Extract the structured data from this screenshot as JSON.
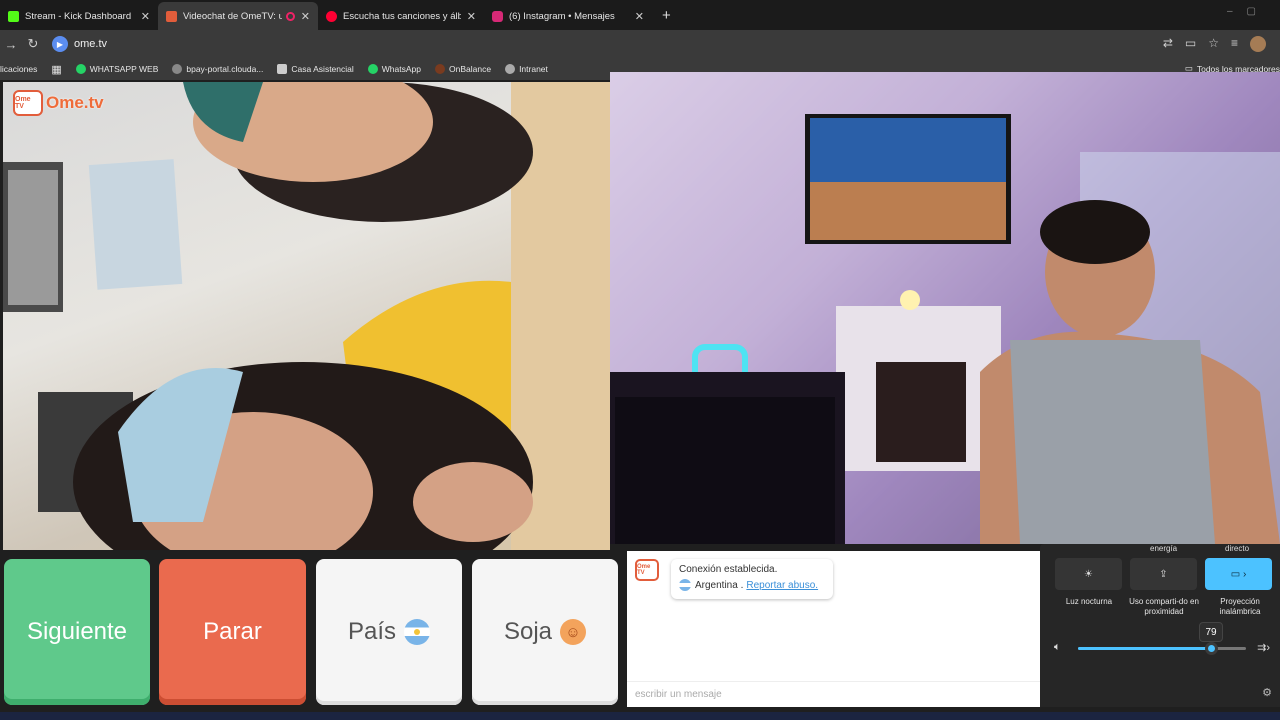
{
  "browser": {
    "tabs": [
      {
        "title": "Stream - Kick Dashboard",
        "favicon_color": "#53fc18",
        "active": false
      },
      {
        "title": "Videochat de OmeTV: una",
        "favicon_color": "#e25d3b",
        "active": true
      },
      {
        "title": "Escucha tus canciones y álbum",
        "favicon_color": "#ff0033",
        "active": false
      },
      {
        "title": "(6) Instagram • Mensajes",
        "favicon_color": "#d62976",
        "active": false
      }
    ],
    "new_tab": "+",
    "url": "ome.tv",
    "bookmarks": [
      {
        "label": "licaciones",
        "color": "#3a3a3a"
      },
      {
        "label": "WHATSAPP WEB",
        "color": "#25d366"
      },
      {
        "label": "bpay-portal.clouda...",
        "color": "#888888"
      },
      {
        "label": "Casa Asistencial",
        "color": "#cccccc"
      },
      {
        "label": "WhatsApp",
        "color": "#25d366"
      },
      {
        "label": "OnBalance",
        "color": "#7a3b1f"
      },
      {
        "label": "Intranet",
        "color": "#aaaaaa"
      }
    ],
    "all_bookmarks": "Todos los marcadores"
  },
  "ometv": {
    "logo_badge": "Ome TV",
    "logo_text": "Ome.tv",
    "buttons": {
      "next": "Siguiente",
      "stop": "Parar",
      "country": "País",
      "gender": "Soja"
    },
    "chat": {
      "status": "Conexión establecida.",
      "country": "Argentina .",
      "report": "Reportar abuso.",
      "placeholder": "escribir un mensaje"
    }
  },
  "quick_settings": {
    "top_labels": [
      "energía",
      "directo"
    ],
    "tiles": [
      {
        "label": "Luz nocturna",
        "icon": "sun-icon",
        "active": false
      },
      {
        "label": "Uso comparti-do en proximidad",
        "icon": "share-icon",
        "active": false
      },
      {
        "label": "Proyección inalámbrica",
        "icon": "cast-icon",
        "active": true
      }
    ],
    "volume": 79,
    "accent": "#4cc2ff"
  }
}
